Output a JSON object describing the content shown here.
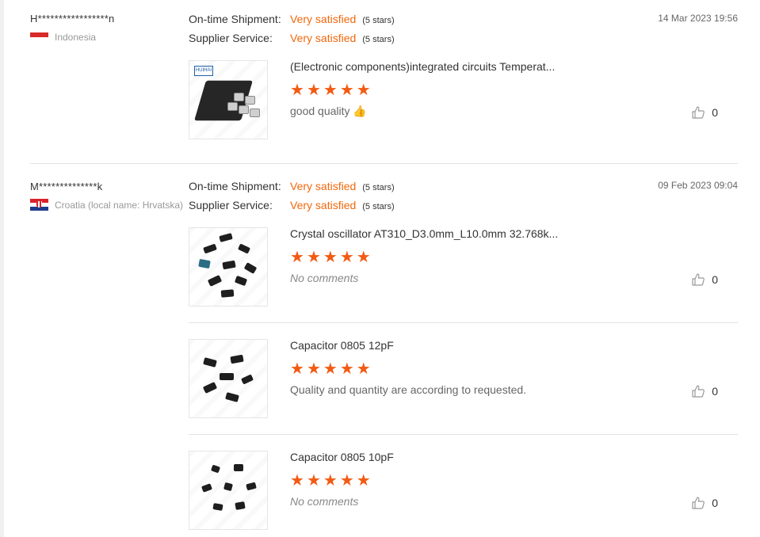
{
  "reviews": [
    {
      "buyer": "H*****************n",
      "country": "Indonesia",
      "flag_colors": [
        "#d72a2a",
        "#ffffff"
      ],
      "shipment_label": "On-time Shipment:",
      "shipment_value": "Very satisfied",
      "shipment_stars": "(5 stars)",
      "service_label": "Supplier Service:",
      "service_value": "Very satisfied",
      "service_stars": "(5 stars)",
      "date": "14 Mar 2023 19:56",
      "items": [
        {
          "title": "(Electronic components)integrated circuits Temperat...",
          "rating": 5,
          "comment": "good quality 👍",
          "likes": "0",
          "thumb_brand": "HUIHAI"
        }
      ]
    },
    {
      "buyer": "M**************k",
      "country": "Croatia (local name: Hrvatska)",
      "flag_colors": [
        "#d9232a",
        "#ffffff",
        "#1f3c8c"
      ],
      "shipment_label": "On-time Shipment:",
      "shipment_value": "Very satisfied",
      "shipment_stars": "(5 stars)",
      "service_label": "Supplier Service:",
      "service_value": "Very satisfied",
      "service_stars": "(5 stars)",
      "date": "09 Feb 2023 09:04",
      "items": [
        {
          "title": "Crystal oscillator AT310_D3.0mm_L10.0mm 32.768k...",
          "rating": 5,
          "comment": "No comments",
          "likes": "0"
        },
        {
          "title": "Capacitor 0805 12pF",
          "rating": 5,
          "comment": "Quality and quantity are according to requested.",
          "likes": "0"
        },
        {
          "title": "Capacitor 0805 10pF",
          "rating": 5,
          "comment": "No comments",
          "likes": "0"
        }
      ]
    }
  ],
  "icons": {
    "star": "star-icon",
    "like": "thumbs-up-icon"
  },
  "accent_color": "#f2680c",
  "star_color": "#f25b13"
}
